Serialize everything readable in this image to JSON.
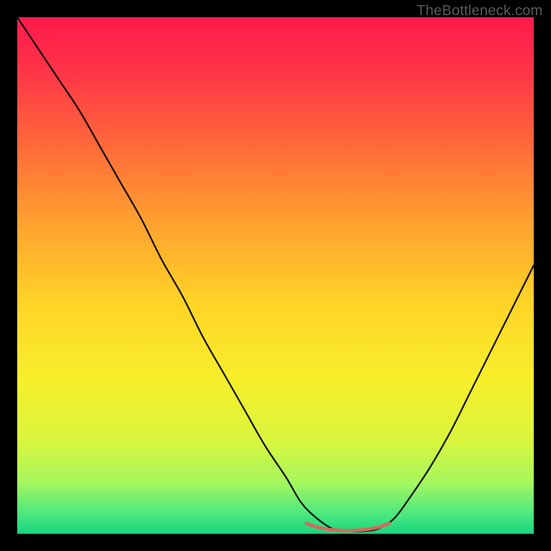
{
  "watermark": "TheBottleneck.com",
  "chart_data": {
    "type": "line",
    "title": "",
    "xlabel": "",
    "ylabel": "",
    "xlim": [
      0,
      100
    ],
    "ylim": [
      0,
      100
    ],
    "grid": false,
    "background_gradient": {
      "stops": [
        {
          "offset": 0.0,
          "color": "#ff1a4b"
        },
        {
          "offset": 0.1,
          "color": "#ff3348"
        },
        {
          "offset": 0.25,
          "color": "#ff6a3a"
        },
        {
          "offset": 0.4,
          "color": "#ffa22f"
        },
        {
          "offset": 0.55,
          "color": "#ffd327"
        },
        {
          "offset": 0.7,
          "color": "#f7ef2a"
        },
        {
          "offset": 0.82,
          "color": "#d9f53d"
        },
        {
          "offset": 0.9,
          "color": "#a6f75e"
        },
        {
          "offset": 0.96,
          "color": "#4ee87f"
        },
        {
          "offset": 1.0,
          "color": "#17d67f"
        }
      ]
    },
    "series": [
      {
        "name": "curve",
        "stroke": "#000000",
        "x": [
          0,
          4,
          8,
          12,
          16,
          20,
          24,
          28,
          32,
          36,
          40,
          44,
          48,
          52,
          55,
          58,
          61,
          64,
          67,
          70,
          73,
          76,
          80,
          84,
          88,
          92,
          96,
          100
        ],
        "y": [
          100,
          94,
          88,
          82,
          75,
          68,
          61,
          53,
          46,
          38,
          31,
          24,
          17,
          11,
          6,
          3,
          1,
          0.5,
          0.5,
          1,
          3,
          7,
          13,
          20,
          28,
          36,
          44,
          52
        ]
      },
      {
        "name": "flat-highlight",
        "stroke": "#d46a5f",
        "stroke_width": 5,
        "x": [
          56,
          58,
          60,
          62,
          64,
          66,
          68,
          70,
          72
        ],
        "y": [
          2.0,
          1.3,
          0.9,
          0.7,
          0.6,
          0.7,
          0.9,
          1.3,
          2.0
        ]
      }
    ]
  }
}
